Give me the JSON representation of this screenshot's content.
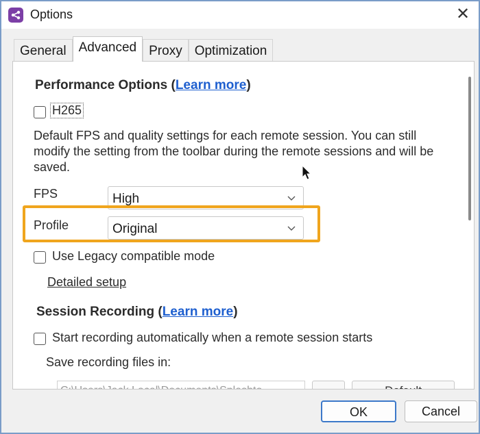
{
  "window": {
    "title": "Options",
    "close_glyph": "✕",
    "app_icon": "app-logo-icon",
    "accent_color": "#7c3fa6"
  },
  "tabs": [
    {
      "label": "General",
      "active": false
    },
    {
      "label": "Advanced",
      "active": true
    },
    {
      "label": "Proxy",
      "active": false
    },
    {
      "label": "Optimization",
      "active": false
    }
  ],
  "performance": {
    "heading": "Performance Options (",
    "learn_more": "Learn more",
    "heading_close": ")",
    "h265_label": "H265",
    "h265_checked": false,
    "description": "Default FPS and quality settings for each remote session. You can still modify the setting from the toolbar during the remote sessions and will be saved.",
    "fps_label": "FPS",
    "fps_value": "High",
    "profile_label": "Profile",
    "profile_value": "Original",
    "legacy_label": "Use Legacy compatible mode",
    "legacy_checked": false,
    "detailed_setup": "Detailed setup"
  },
  "recording": {
    "heading": "Session Recording (",
    "learn_more": "Learn more",
    "heading_close": ")",
    "auto_start_label": "Start recording automatically when a remote session starts",
    "auto_start_checked": false,
    "save_label": "Save recording files in:",
    "path_value": "C:\\Users\\Jack.Local\\Documents\\Splashto",
    "default_label": "Default"
  },
  "footer": {
    "ok_label": "OK",
    "cancel_label": "Cancel"
  },
  "highlight_color": "#f0a51d"
}
